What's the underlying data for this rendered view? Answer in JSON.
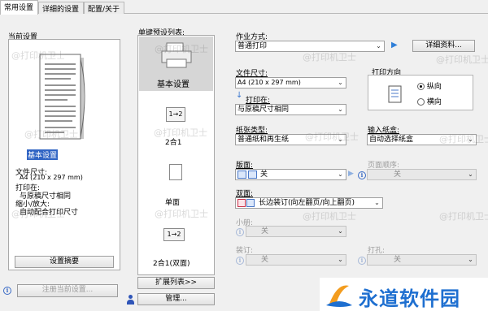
{
  "tabs": [
    {
      "label": "常用设置",
      "active": true
    },
    {
      "label": "详细的设置",
      "active": false
    },
    {
      "label": "配置/关于",
      "active": false
    }
  ],
  "current_settings": {
    "title": "当前设置",
    "preset_label": "基本设置",
    "paper_size_label": "文件尺寸:",
    "paper_size_value": "A4 (210 x 297 mm)",
    "print_on_label": "打印在:",
    "print_on_value": "与原稿尺寸相同",
    "scale_label": "缩小/放大:",
    "scale_value": "自动配合打印尺寸",
    "summary_button": "设置摘要"
  },
  "register_button": "注册当前设置...",
  "presets": {
    "title": "单键预设列表:",
    "items": [
      {
        "label": "基本设置",
        "icon": "printer-icon",
        "selected": true
      },
      {
        "label": "2合1",
        "icon": "two-in-one-icon",
        "glyph": "1→2",
        "selected": false
      },
      {
        "label": "单面",
        "icon": "single-sided-icon",
        "selected": false
      },
      {
        "label": "2合1(双面)",
        "icon": "two-in-one-duplex-icon",
        "glyph": "1→2",
        "selected": false
      }
    ],
    "expand_button": "扩展列表>>",
    "manage_button": "管理..."
  },
  "job": {
    "method_label": "作业方式:",
    "method_value": "普通打印",
    "detail_button": "详细资料..."
  },
  "paper_size": {
    "label": "文件尺寸:",
    "value": "A4 (210 x 297 mm)"
  },
  "print_on": {
    "label": "打印在:",
    "value": "与原稿尺寸相同"
  },
  "orientation": {
    "title": "打印方向",
    "options": [
      {
        "label": "纵向",
        "checked": true
      },
      {
        "label": "横向",
        "checked": false
      }
    ]
  },
  "paper_type": {
    "label": "纸张类型:",
    "value": "普通纸和再生纸"
  },
  "input_tray": {
    "label": "输入纸盒:",
    "value": "自动选择纸盒"
  },
  "layout": {
    "label": "版面:",
    "value": "关"
  },
  "page_order": {
    "label": "页面顺序:",
    "value": "关"
  },
  "duplex": {
    "label": "双面:",
    "value": "长边装订(向左翻页/向上翻页)"
  },
  "booklet": {
    "label": "小册:",
    "value": "关"
  },
  "binding": {
    "label": "装订:",
    "value": "关"
  },
  "punch": {
    "label": "打孔:",
    "value": "关"
  },
  "watermarks": {
    "text": "@打印机卫士"
  },
  "brand": {
    "name": "永道软件园",
    "color_blue": "#1e6fd0",
    "color_orange": "#f39c1e"
  }
}
